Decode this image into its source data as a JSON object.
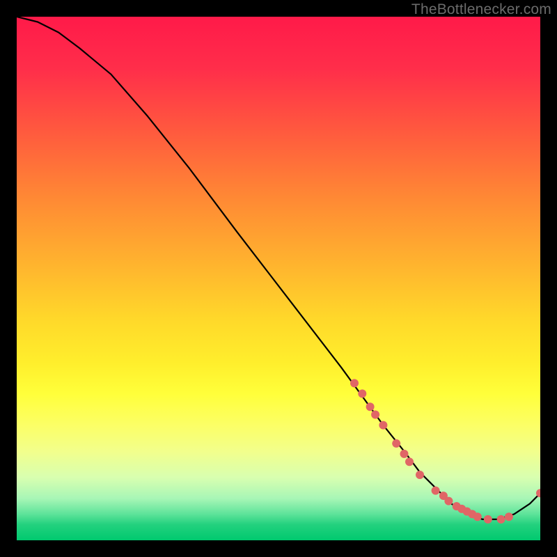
{
  "watermark": "TheBottlenecker.com",
  "chart_data": {
    "type": "line",
    "title": "",
    "xlabel": "",
    "ylabel": "",
    "xlim": [
      0,
      100
    ],
    "ylim": [
      0,
      100
    ],
    "grid": false,
    "series": [
      {
        "name": "bottleneck-curve",
        "color": "#000000",
        "x": [
          0,
          4,
          8,
          12,
          18,
          25,
          33,
          42,
          52,
          62,
          70,
          74,
          77,
          80,
          83,
          86,
          89,
          92,
          95,
          98,
          100
        ],
        "y": [
          100,
          99,
          97,
          94,
          89,
          81,
          71,
          59,
          46,
          33,
          22,
          17,
          13,
          10,
          7,
          5,
          4,
          4,
          5,
          7,
          9
        ]
      }
    ],
    "markers": [
      {
        "x": 64.5,
        "y": 30.0
      },
      {
        "x": 66.0,
        "y": 28.0
      },
      {
        "x": 67.5,
        "y": 25.5
      },
      {
        "x": 68.5,
        "y": 24.0
      },
      {
        "x": 70.0,
        "y": 22.0
      },
      {
        "x": 72.5,
        "y": 18.5
      },
      {
        "x": 74.0,
        "y": 16.5
      },
      {
        "x": 75.0,
        "y": 15.0
      },
      {
        "x": 77.0,
        "y": 12.5
      },
      {
        "x": 80.0,
        "y": 9.5
      },
      {
        "x": 81.5,
        "y": 8.5
      },
      {
        "x": 82.5,
        "y": 7.5
      },
      {
        "x": 84.0,
        "y": 6.5
      },
      {
        "x": 85.0,
        "y": 6.0
      },
      {
        "x": 86.0,
        "y": 5.5
      },
      {
        "x": 87.0,
        "y": 5.0
      },
      {
        "x": 88.0,
        "y": 4.5
      },
      {
        "x": 90.0,
        "y": 4.0
      },
      {
        "x": 92.5,
        "y": 4.0
      },
      {
        "x": 94.0,
        "y": 4.5
      },
      {
        "x": 100.0,
        "y": 9.0
      }
    ],
    "marker_style": {
      "color": "#e06666",
      "radius_px": 6
    }
  }
}
